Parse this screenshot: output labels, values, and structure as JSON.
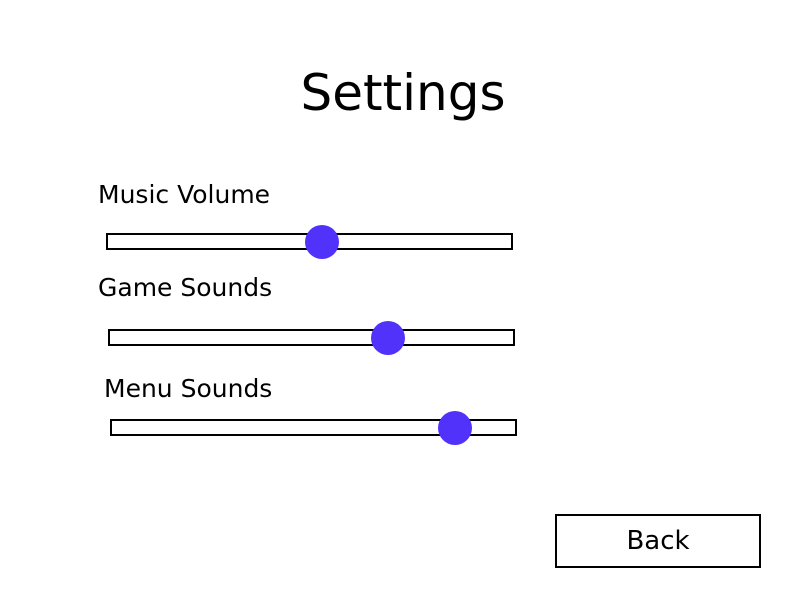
{
  "title": "Settings",
  "accent_color": "#5032fa",
  "sliders": [
    {
      "label": "Music Volume",
      "value_percent": 53
    },
    {
      "label": "Game Sounds",
      "value_percent": 69
    },
    {
      "label": "Menu Sounds",
      "value_percent": 85
    }
  ],
  "back_button": {
    "label": "Back"
  }
}
